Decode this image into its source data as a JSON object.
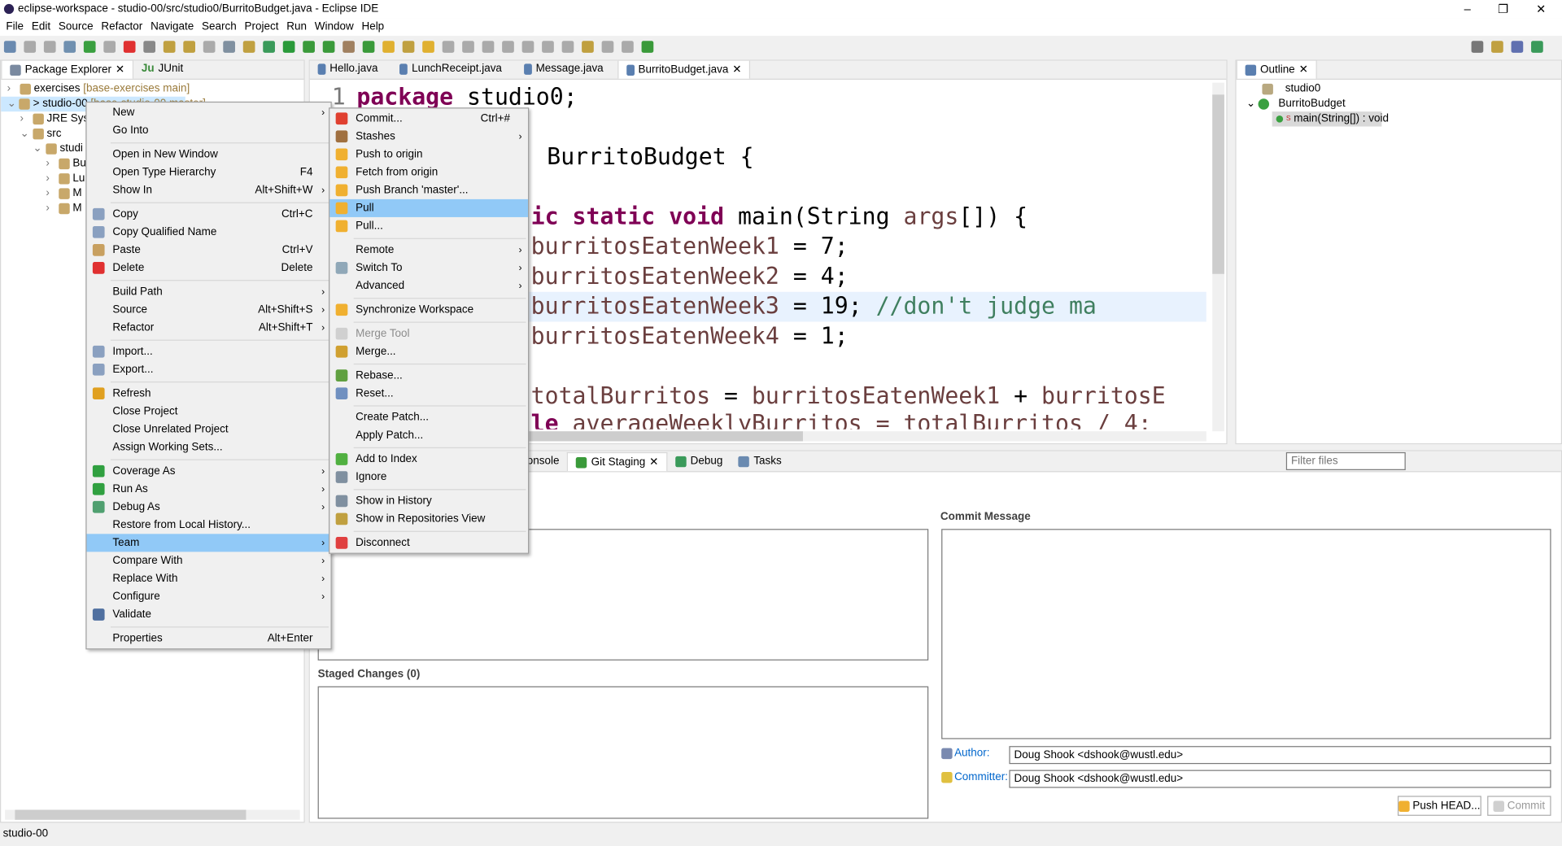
{
  "window": {
    "title": "eclipse-workspace - studio-00/src/studio0/BurritoBudget.java - Eclipse IDE",
    "controls": [
      "–",
      "❐",
      "✕"
    ]
  },
  "menubar": [
    "File",
    "Edit",
    "Source",
    "Refactor",
    "Navigate",
    "Search",
    "Project",
    "Run",
    "Window",
    "Help"
  ],
  "left_panel": {
    "tabs": [
      "Package Explorer",
      "JUnit"
    ],
    "tree": [
      {
        "label": "exercises",
        "decor": "[base-exercises main]",
        "indent": 0,
        "arrow": "›"
      },
      {
        "label": "> studio-00",
        "decor": "[base-studio-00 master]",
        "indent": 0,
        "arrow": "⌄",
        "selected": true
      },
      {
        "label": "JRE Syste",
        "indent": 1,
        "arrow": "›"
      },
      {
        "label": "src",
        "indent": 1,
        "arrow": "⌄"
      },
      {
        "label": "studi",
        "indent": 2,
        "arrow": "⌄"
      },
      {
        "label": "Bu",
        "indent": 3,
        "arrow": "›"
      },
      {
        "label": "Lu",
        "indent": 3,
        "arrow": "›"
      },
      {
        "label": "M",
        "indent": 3,
        "arrow": "›"
      },
      {
        "label": "M",
        "indent": 3,
        "arrow": "›"
      }
    ]
  },
  "editor": {
    "tabs": [
      "Hello.java",
      "LunchReceipt.java",
      "Message.java",
      "BurritoBudget.java"
    ],
    "active_tab": 3,
    "line_number": "1",
    "lines": {
      "l1kw": "package",
      "l1": " studio0;",
      "l3": "BurritoBudget {",
      "l5kw": "ic static void",
      "l5": " main(String ",
      "l5var": "args",
      "l5b": "[]) {",
      "l6var": "burritosEatenWeek1",
      "l6": " = 7;",
      "l7var": "burritosEatenWeek2",
      "l7": " = 4;",
      "l8var": "burritosEatenWeek3",
      "l8": " = 19; ",
      "l8cm": "//don't judge ma",
      "l9var": "burritosEatenWeek4",
      "l9": " = 1;",
      "l11var": "totalBurritos",
      "l11": " = ",
      "l11var2": "burritosEatenWeek1",
      "l11b": " + ",
      "l11var3": "burritosE",
      "l12kw": "le",
      "l12": " averageWeeklyBurritos = totalBurritos / 4;"
    }
  },
  "outline": {
    "tab": "Outline",
    "items": [
      {
        "label": "studio0"
      },
      {
        "label": "BurritoBudget"
      },
      {
        "label": "main(String[]) : void"
      }
    ]
  },
  "bottom": {
    "tabs": [
      "onsole",
      "Git Staging",
      "Debug",
      "Tasks"
    ],
    "filter_placeholder": "Filter files",
    "staged_header": "Staged Changes (0)",
    "commit_message_header": "Commit Message",
    "author_label": "Author:",
    "author_value": "Doug Shook <dshook@wustl.edu>",
    "committer_label": "Committer:",
    "committer_value": "Doug Shook <dshook@wustl.edu>",
    "push_button": "Push HEAD...",
    "commit_button": "Commit"
  },
  "status_bar": {
    "text": "studio-00"
  },
  "context_menu": [
    {
      "label": "New",
      "arrow": true
    },
    {
      "label": "Go Into"
    },
    {
      "sep": true
    },
    {
      "label": "Open in New Window"
    },
    {
      "label": "Open Type Hierarchy",
      "shortcut": "F4"
    },
    {
      "label": "Show In",
      "shortcut": "Alt+Shift+W",
      "arrow": true
    },
    {
      "sep": true
    },
    {
      "label": "Copy",
      "shortcut": "Ctrl+C",
      "icon": "#8aa0c0"
    },
    {
      "label": "Copy Qualified Name",
      "icon": "#8aa0c0"
    },
    {
      "label": "Paste",
      "shortcut": "Ctrl+V",
      "icon": "#c8a060"
    },
    {
      "label": "Delete",
      "shortcut": "Delete",
      "icon": "#e03030"
    },
    {
      "sep": true
    },
    {
      "label": "Build Path",
      "arrow": true
    },
    {
      "label": "Source",
      "shortcut": "Alt+Shift+S",
      "arrow": true
    },
    {
      "label": "Refactor",
      "shortcut": "Alt+Shift+T",
      "arrow": true
    },
    {
      "sep": true
    },
    {
      "label": "Import...",
      "icon": "#8aa0c0"
    },
    {
      "label": "Export...",
      "icon": "#8aa0c0"
    },
    {
      "sep": true
    },
    {
      "label": "Refresh",
      "icon": "#e0a020"
    },
    {
      "label": "Close Project"
    },
    {
      "label": "Close Unrelated Project"
    },
    {
      "label": "Assign Working Sets..."
    },
    {
      "sep": true
    },
    {
      "label": "Coverage As",
      "arrow": true,
      "icon": "#30a040"
    },
    {
      "label": "Run As",
      "arrow": true,
      "icon": "#30a040"
    },
    {
      "label": "Debug As",
      "arrow": true,
      "icon": "#50a070"
    },
    {
      "label": "Restore from Local History..."
    },
    {
      "label": "Team",
      "arrow": true,
      "highlighted": true
    },
    {
      "label": "Compare With",
      "arrow": true
    },
    {
      "label": "Replace With",
      "arrow": true
    },
    {
      "label": "Configure",
      "arrow": true
    },
    {
      "label": "Validate",
      "icon": "#5070a0",
      "check": "✓"
    },
    {
      "sep": true
    },
    {
      "label": "Properties",
      "shortcut": "Alt+Enter"
    }
  ],
  "team_menu": [
    {
      "label": "Commit...",
      "shortcut": "Ctrl+#",
      "icon": "#e04030"
    },
    {
      "label": "Stashes",
      "arrow": true,
      "icon": "#a07040"
    },
    {
      "label": "Push to origin",
      "icon": "#f0b030"
    },
    {
      "label": "Fetch from origin",
      "icon": "#f0b030"
    },
    {
      "label": "Push Branch 'master'...",
      "icon": "#f0b030"
    },
    {
      "label": "Pull",
      "icon": "#f0b030",
      "highlighted": true
    },
    {
      "label": "Pull...",
      "icon": "#f0b030"
    },
    {
      "sep": true
    },
    {
      "label": "Remote",
      "arrow": true
    },
    {
      "label": "Switch To",
      "arrow": true,
      "icon": "#90a8b8"
    },
    {
      "label": "Advanced",
      "arrow": true
    },
    {
      "sep": true
    },
    {
      "label": "Synchronize Workspace",
      "icon": "#f0b030"
    },
    {
      "sep": true
    },
    {
      "label": "Merge Tool",
      "disabled": true,
      "icon": "#d0d0d0"
    },
    {
      "label": "Merge...",
      "icon": "#d0a030"
    },
    {
      "sep": true
    },
    {
      "label": "Rebase...",
      "icon": "#60a040"
    },
    {
      "label": "Reset...",
      "icon": "#7090c0"
    },
    {
      "sep": true
    },
    {
      "label": "Create Patch..."
    },
    {
      "label": "Apply Patch..."
    },
    {
      "sep": true
    },
    {
      "label": "Add to Index",
      "icon": "#50b040"
    },
    {
      "label": "Ignore",
      "icon": "#8090a0"
    },
    {
      "sep": true
    },
    {
      "label": "Show in History",
      "icon": "#8090a0"
    },
    {
      "label": "Show in Repositories View",
      "icon": "#c0a040"
    },
    {
      "sep": true
    },
    {
      "label": "Disconnect",
      "icon": "#e04040"
    }
  ],
  "colors": {
    "selection": "#91c9f7",
    "keyword": "#7f0055",
    "variable": "#6a3e3e",
    "comment": "#3f7f5f",
    "current_line": "#e8f2fe",
    "link": "#0066cc"
  }
}
